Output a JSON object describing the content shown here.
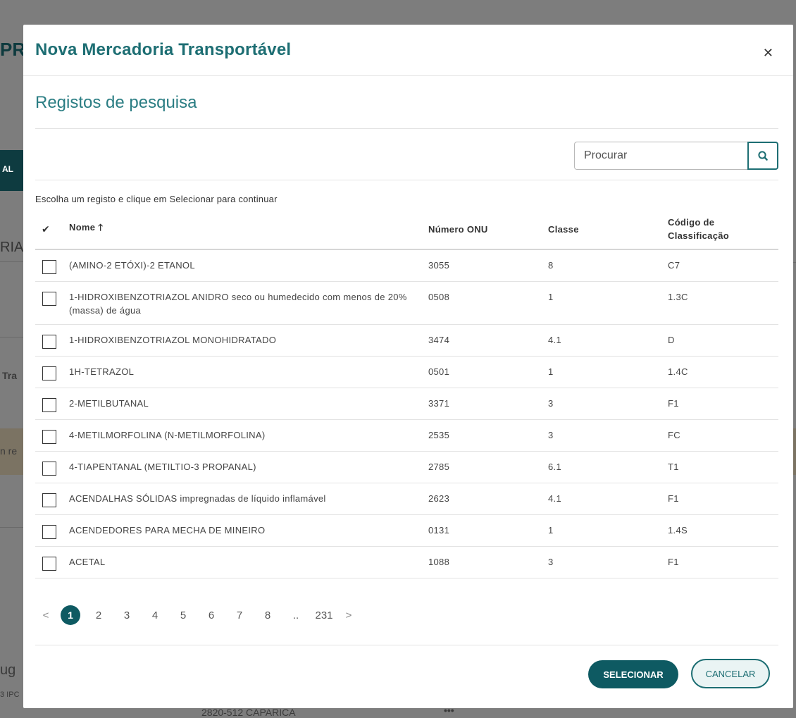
{
  "background": {
    "fragments": [
      "PR",
      "AL",
      "RIA",
      "Tra",
      "n re",
      "ug",
      "3 IPC",
      "2820-512 CAPARICA"
    ]
  },
  "modal": {
    "title": "Nova Mercadoria Transportável",
    "close_icon": "close-icon",
    "section_title": "Registos de pesquisa",
    "search": {
      "placeholder": "Procurar",
      "value": "",
      "icon": "search-icon"
    },
    "instructions": "Escolha um registo e clique em Selecionar para continuar",
    "table": {
      "columns": {
        "check_icon": "✔",
        "nome": "Nome",
        "sort_icon": "sort-up-icon",
        "onu": "Número ONU",
        "classe": "Classe",
        "codigo": "Código de Classificação"
      },
      "rows": [
        {
          "nome": "(AMINO-2 ETÓXI)-2 ETANOL",
          "onu": "3055",
          "classe": "8",
          "codigo": "C7"
        },
        {
          "nome": "1-HIDROXIBENZOTRIAZOL ANIDRO seco ou humedecido com menos de 20% (massa) de água",
          "onu": "0508",
          "classe": "1",
          "codigo": "1.3C"
        },
        {
          "nome": "1-HIDROXIBENZOTRIAZOL MONOHIDRATADO",
          "onu": "3474",
          "classe": "4.1",
          "codigo": "D"
        },
        {
          "nome": "1H-TETRAZOL",
          "onu": "0501",
          "classe": "1",
          "codigo": "1.4C"
        },
        {
          "nome": "2-METILBUTANAL",
          "onu": "3371",
          "classe": "3",
          "codigo": "F1"
        },
        {
          "nome": "4-METILMORFOLINA (N-METILMORFOLINA)",
          "onu": "2535",
          "classe": "3",
          "codigo": "FC"
        },
        {
          "nome": "4-TIAPENTANAL (METILTIO-3 PROPANAL)",
          "onu": "2785",
          "classe": "6.1",
          "codigo": "T1"
        },
        {
          "nome": "ACENDALHAS SÓLIDAS impregnadas de líquido inflamável",
          "onu": "2623",
          "classe": "4.1",
          "codigo": "F1"
        },
        {
          "nome": "ACENDEDORES PARA MECHA DE MINEIRO",
          "onu": "0131",
          "classe": "1",
          "codigo": "1.4S"
        },
        {
          "nome": "ACETAL",
          "onu": "1088",
          "classe": "3",
          "codigo": "F1"
        }
      ]
    },
    "pagination": {
      "prev": "<",
      "pages": [
        "1",
        "2",
        "3",
        "4",
        "5",
        "6",
        "7",
        "8"
      ],
      "active": "1",
      "ellipsis": "..",
      "last": "231",
      "next": ">"
    },
    "buttons": {
      "select": "SELECIONAR",
      "cancel": "CANCELAR"
    }
  },
  "colors": {
    "accent": "#1d6e73",
    "accent_dark": "#0e5a62",
    "overlay": "#7d7d7d"
  }
}
